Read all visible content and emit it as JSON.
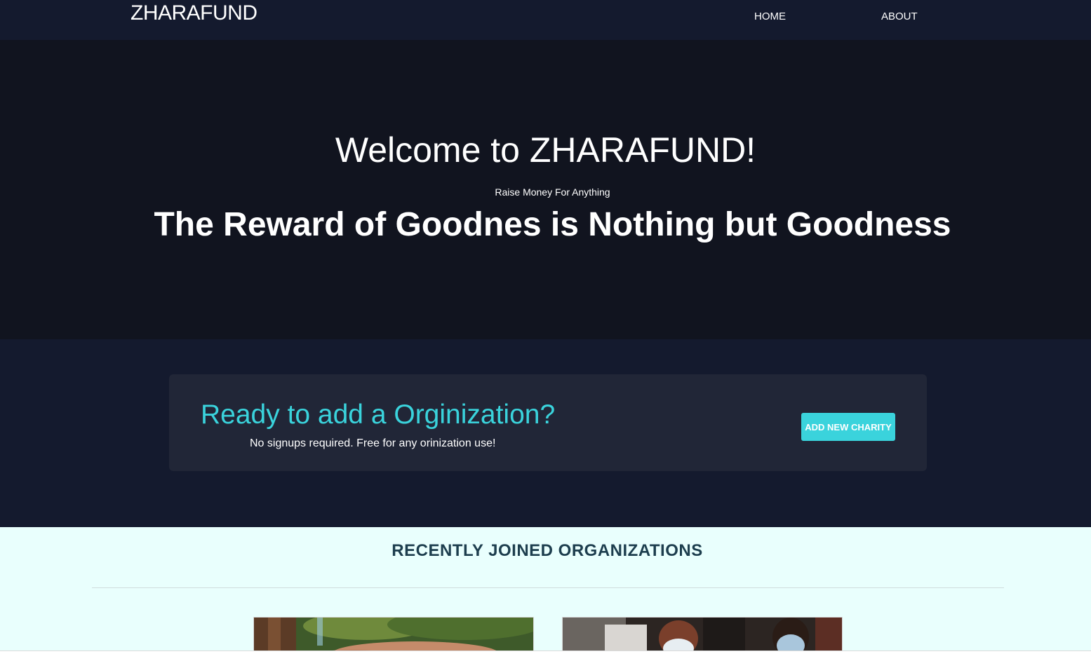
{
  "nav": {
    "brand": "ZHARAFUND",
    "links": [
      "HOME",
      "ABOUT"
    ]
  },
  "hero": {
    "title": "Welcome to ZHARAFUND!",
    "subtitle": "Raise Money For Anything",
    "tagline": "The Reward of Goodnes is Nothing but Goodness"
  },
  "cta": {
    "title": "Ready to add a Orginization?",
    "text": "No signups required. Free for any orinization use!",
    "button_label": "ADD NEW CHARITY"
  },
  "organizations": {
    "title": "RECENTLY JOINED ORGANIZATIONS"
  },
  "colors": {
    "nav_bg": "#141a2e",
    "hero_bg": "#11141f",
    "card_bg": "#212637",
    "accent": "#3ad3dc",
    "orgs_bg": "#e9fffd",
    "orgs_title": "#1d3e4e"
  }
}
